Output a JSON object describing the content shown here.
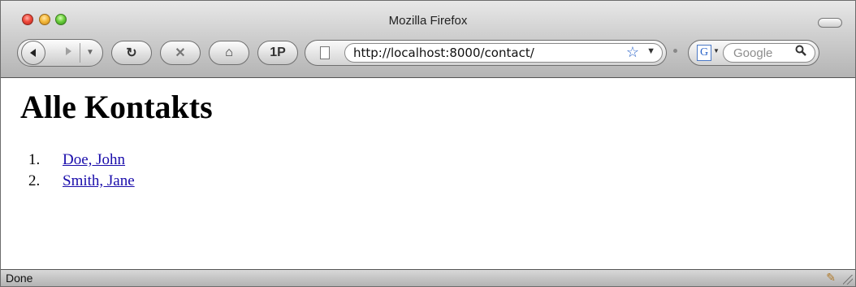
{
  "window": {
    "title": "Mozilla Firefox"
  },
  "toolbar": {
    "back_icon": "back-arrow-icon",
    "forward_icon": "forward-arrow-icon",
    "reload_glyph": "↻",
    "stop_glyph": "✕",
    "home_glyph": "⌂",
    "onep_label": "1P"
  },
  "address": {
    "url": "http://localhost:8000/contact/",
    "star_glyph": "☆",
    "drop_glyph": "▼"
  },
  "search": {
    "engine_letter": "G",
    "placeholder": "Google",
    "button_glyph": "🔍"
  },
  "page": {
    "heading": "Alle Kontakts",
    "contacts": [
      {
        "num": "1.",
        "name": "Doe, John"
      },
      {
        "num": "2.",
        "name": "Smith, Jane"
      }
    ]
  },
  "status": {
    "text": "Done"
  },
  "colors": {
    "link": "#1a0dab",
    "accent": "#2a63c8"
  }
}
